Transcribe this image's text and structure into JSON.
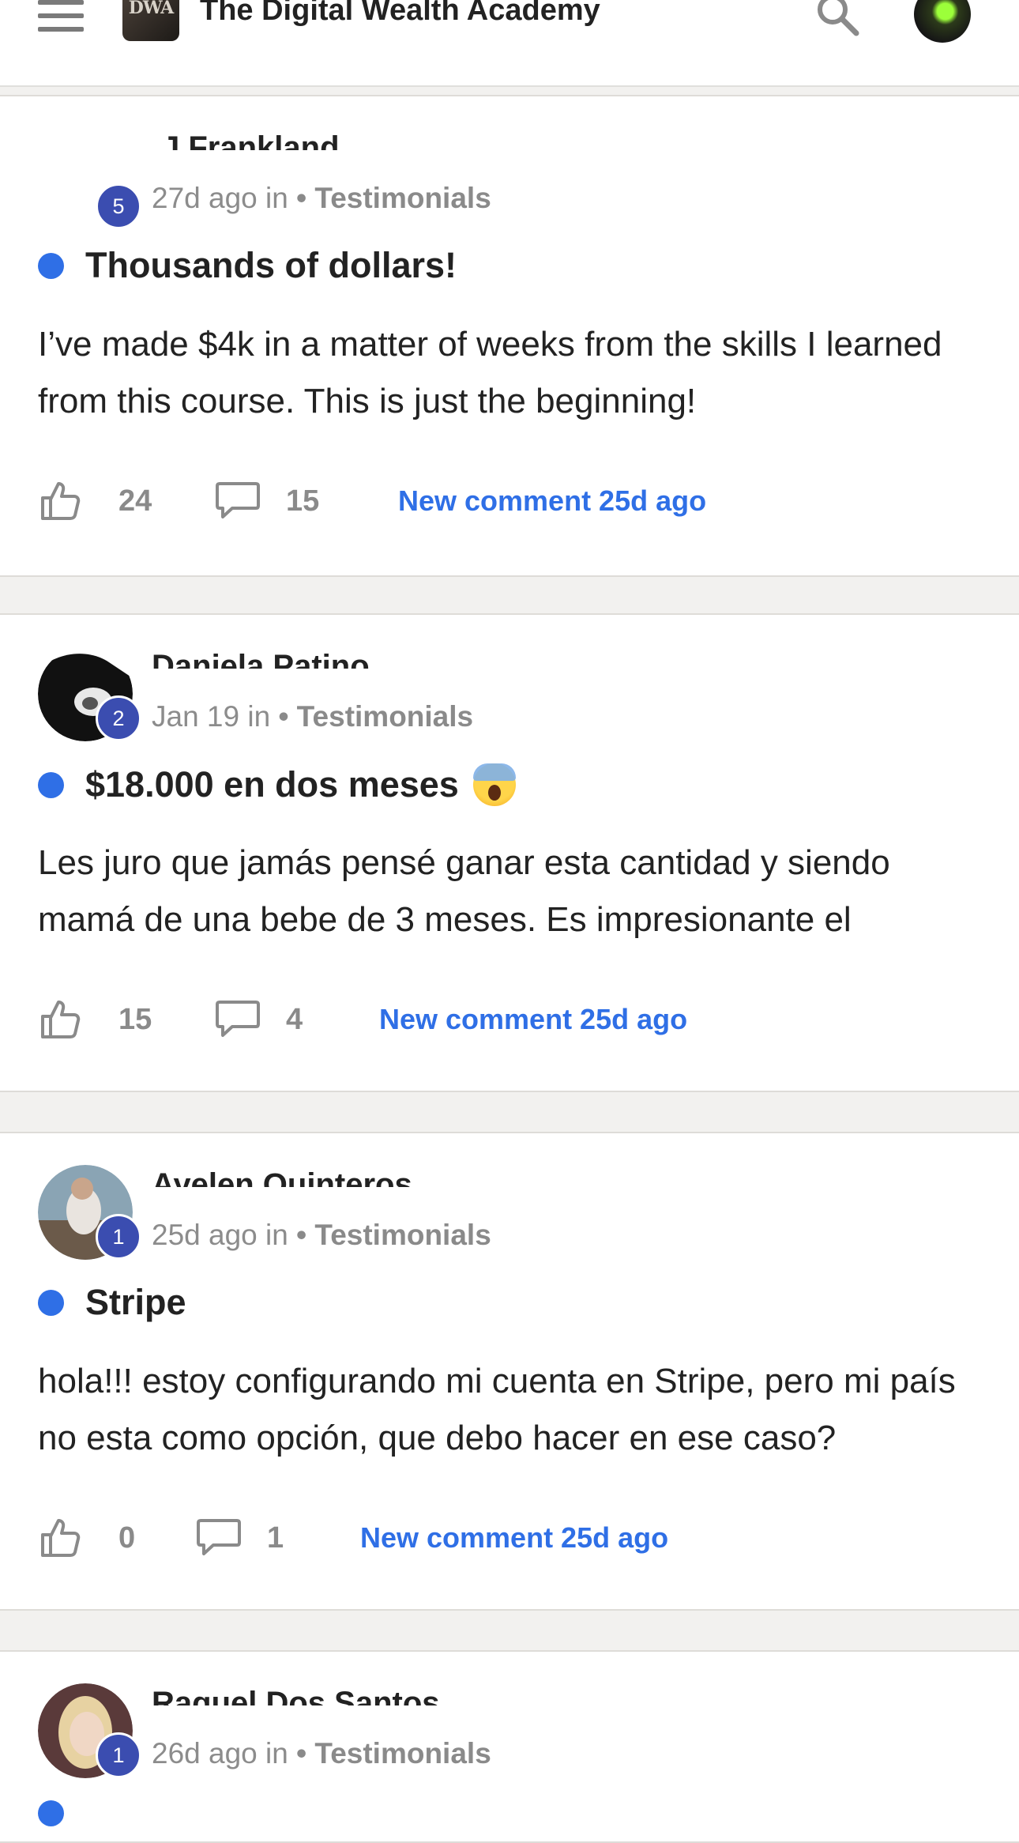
{
  "app": {
    "title": "The Digital Wealth Academy",
    "logo_text": "DWA",
    "accent_color": "#2f6fe6",
    "badge_color": "#3b4db0"
  },
  "posts": [
    {
      "author": "J Frankland",
      "level": "5",
      "time": "27d ago in",
      "category": "• Testimonials",
      "title": "Thousands of dollars!",
      "body": "I’ve made $4k in a matter of weeks from the skills I learned from this course. This is just the beginning!",
      "likes": "24",
      "comments": "15",
      "new_comment": "New comment 25d ago"
    },
    {
      "author": "Daniela Patino",
      "level": "2",
      "time": "Jan 19 in",
      "category": "• Testimonials",
      "title": "$18.000 en dos meses",
      "body": "Les juro que jamás pensé ganar esta cantidad y siendo mamá de una bebe de 3 meses. Es impresionante el",
      "likes": "15",
      "comments": "4",
      "new_comment": "New comment 25d ago"
    },
    {
      "author": "Ayelen Quinteros",
      "level": "1",
      "time": "25d ago in",
      "category": "• Testimonials",
      "title": "Stripe",
      "body": "hola!!! estoy configurando mi cuenta en Stripe, pero mi país no esta como opción, que debo hacer en ese caso?",
      "likes": "0",
      "comments": "1",
      "new_comment": "New comment 25d ago"
    },
    {
      "author": "Raquel Dos Santos",
      "level": "1",
      "time": "26d ago in",
      "category": "• Testimonials"
    }
  ]
}
